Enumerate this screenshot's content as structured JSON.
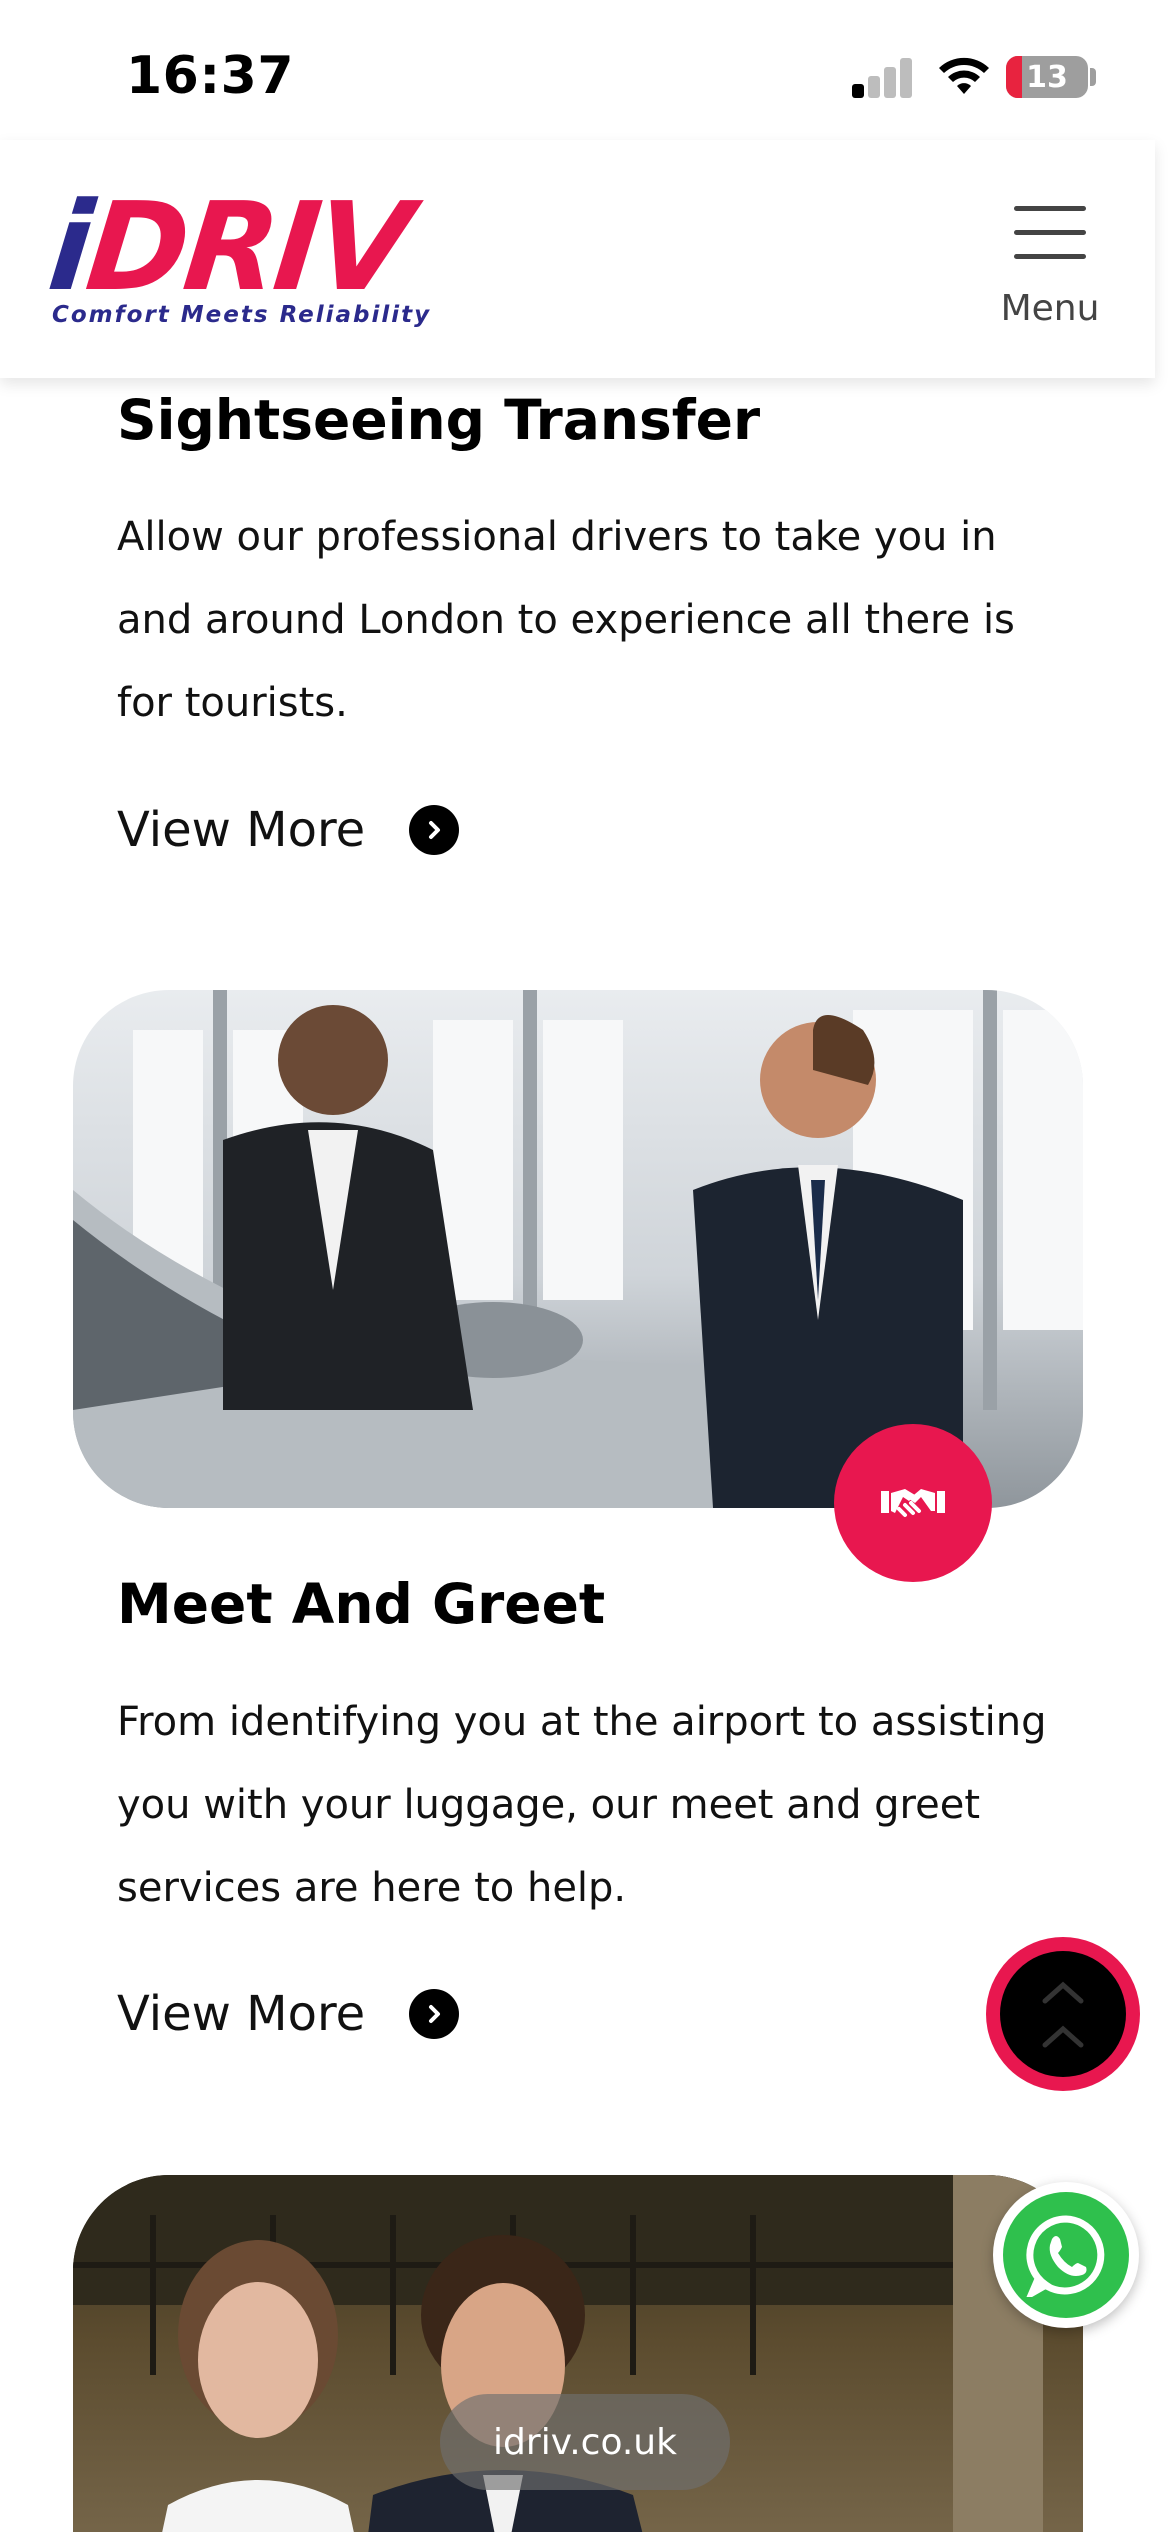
{
  "status_bar": {
    "time": "16:37",
    "battery_percent": "13",
    "signal_bars_active": 1,
    "signal_bars_total": 4
  },
  "header": {
    "logo_letter_i": "i",
    "logo_letters_rest": "DRIV",
    "logo_tagline": "Comfort Meets Reliability",
    "menu_label": "Menu",
    "brand_blue": "#2b2a8c",
    "brand_red": "#e8174f"
  },
  "services": [
    {
      "title": "Sightseeing Transfer",
      "description": "Allow our professional drivers to take you in and around London to experience all there is for tourists.",
      "cta": "View More"
    },
    {
      "title": "Meet And Greet",
      "description": "From identifying you at the airport to assisting you with your luggage, our meet and greet services are here to help.",
      "cta": "View More",
      "icon": "handshake-icon"
    }
  ],
  "browser": {
    "url": "idriv.co.uk"
  }
}
